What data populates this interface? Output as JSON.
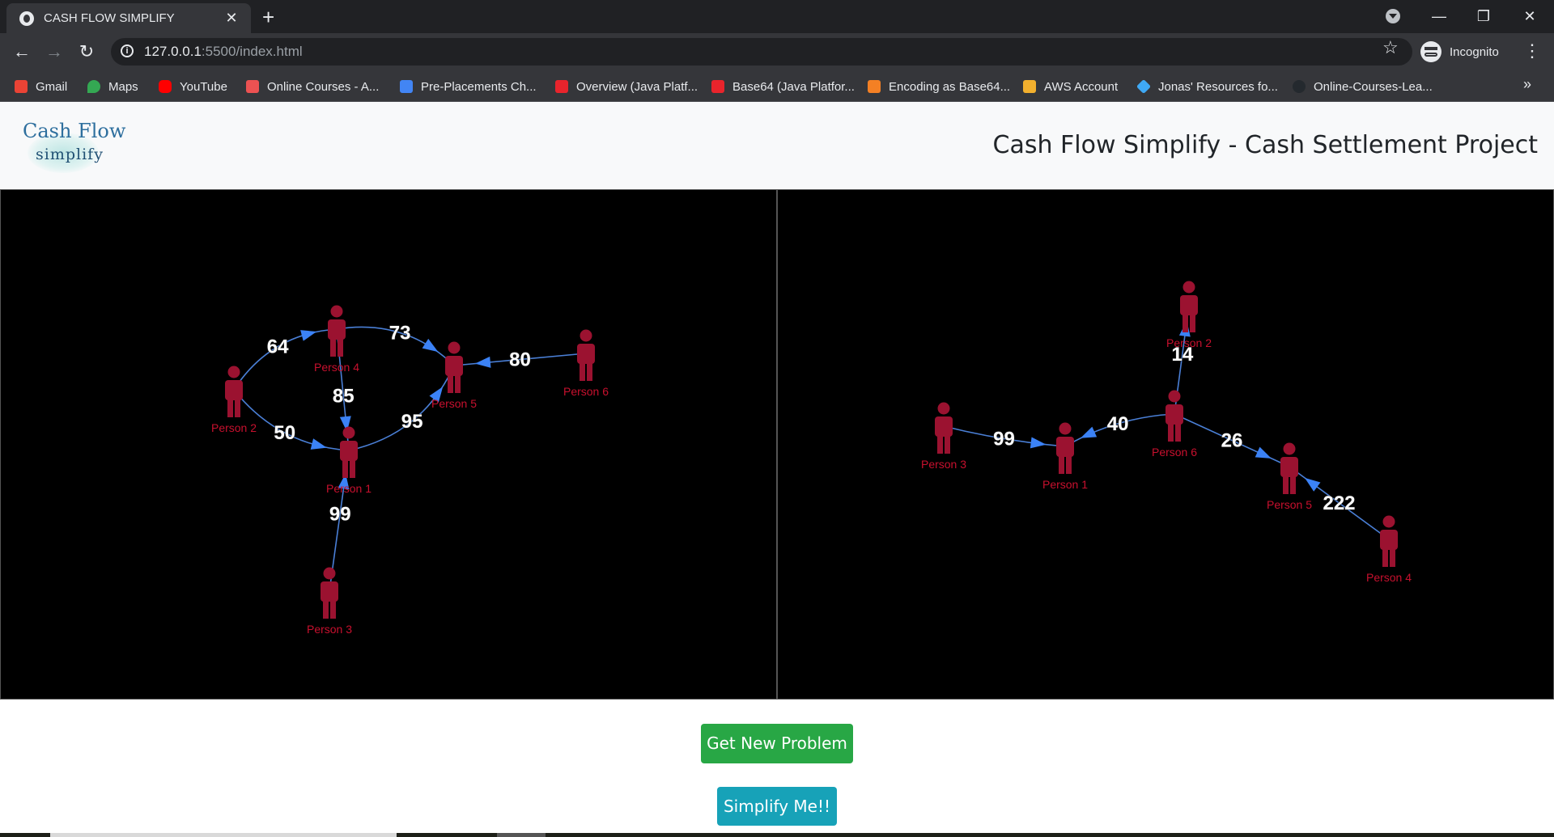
{
  "browser": {
    "tab_title": "CASH FLOW SIMPLIFY",
    "new_tab": "+",
    "url_host": "127.0.0.1",
    "url_rest": ":5500/index.html",
    "profile_label": "Incognito",
    "bookmarks": [
      {
        "label": "Gmail",
        "icon": "gmail-icon",
        "color": "#ea4335"
      },
      {
        "label": "Maps",
        "icon": "maps-icon",
        "color": "#34a853"
      },
      {
        "label": "YouTube",
        "icon": "youtube-icon",
        "color": "#ff0000"
      },
      {
        "label": "Online Courses - A...",
        "icon": "udemy-icon",
        "color": "#ec5252"
      },
      {
        "label": "Pre-Placements Ch...",
        "icon": "docs-icon",
        "color": "#4285f4"
      },
      {
        "label": "Overview (Java Platf...",
        "icon": "oracle-icon",
        "color": "#e8242c"
      },
      {
        "label": "Base64 (Java Platfor...",
        "icon": "oracle-icon",
        "color": "#e8242c"
      },
      {
        "label": "Encoding as Base64...",
        "icon": "stackoverflow-icon",
        "color": "#f48024"
      },
      {
        "label": "AWS Account",
        "icon": "aws-icon",
        "color": "#f2b02e"
      },
      {
        "label": "Jonas' Resources fo...",
        "icon": "diamond-icon",
        "color": "#3fa9f5"
      },
      {
        "label": "Online-Courses-Lea...",
        "icon": "github-icon",
        "color": "#24292e"
      }
    ],
    "more_bookmarks": "»"
  },
  "navbar": {
    "brand_line1": "Cash Flow",
    "brand_line2": "simplify",
    "title": "Cash Flow Simplify - Cash Settlement Project"
  },
  "colors": {
    "node": "#9b1230",
    "node_label": "#c8102e",
    "edge": "#4a7fd6",
    "arrow": "#3b82f6",
    "panel_bg": "#000000"
  },
  "graphs": {
    "problem": {
      "nodes": [
        "Person 1",
        "Person 2",
        "Person 3",
        "Person 4",
        "Person 5",
        "Person 6"
      ],
      "edges": [
        {
          "from": "Person 2",
          "to": "Person 4",
          "amount": "64"
        },
        {
          "from": "Person 4",
          "to": "Person 5",
          "amount": "73"
        },
        {
          "from": "Person 6",
          "to": "Person 5",
          "amount": "80"
        },
        {
          "from": "Person 4",
          "to": "Person 1",
          "amount": "85"
        },
        {
          "from": "Person 1",
          "to": "Person 5",
          "amount": "95"
        },
        {
          "from": "Person 2",
          "to": "Person 1",
          "amount": "50"
        },
        {
          "from": "Person 3",
          "to": "Person 1",
          "amount": "99"
        }
      ]
    },
    "simplified": {
      "nodes": [
        "Person 1",
        "Person 2",
        "Person 3",
        "Person 4",
        "Person 5",
        "Person 6"
      ],
      "edges": [
        {
          "from": "Person 6",
          "to": "Person 2",
          "amount": "14"
        },
        {
          "from": "Person 3",
          "to": "Person 1",
          "amount": "99"
        },
        {
          "from": "Person 6",
          "to": "Person 1",
          "amount": "40"
        },
        {
          "from": "Person 6",
          "to": "Person 5",
          "amount": "26"
        },
        {
          "from": "Person 4",
          "to": "Person 5",
          "amount": "222"
        }
      ]
    }
  },
  "buttons": {
    "new_problem": "Get New Problem",
    "simplify": "Simplify Me!!"
  }
}
